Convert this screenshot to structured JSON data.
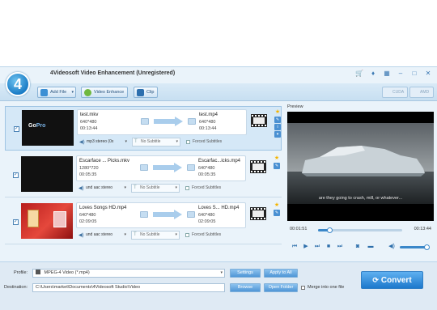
{
  "app": {
    "title": "4Videosoft Video Enhancement (Unregistered)",
    "logo_text": "4",
    "title_icons": [
      "cart-icon",
      "key-icon",
      "grid-icon",
      "minimize-icon",
      "maximize-icon",
      "close-icon"
    ]
  },
  "toolbar": {
    "add_file": "Add File",
    "video_enhance": "Video Enhance",
    "clip": "Clip",
    "cuda": "CUDA",
    "amd": "AMD"
  },
  "files": [
    {
      "checked": true,
      "source_name": "test.mkv",
      "source_res": "640*480",
      "source_dur": "00:13:44",
      "target_name": "test.mp4",
      "target_res": "640*480",
      "target_dur": "00:13:44",
      "audio": "mp3 stereo (0x",
      "subtitle": "No Subtitle",
      "forced": "Forced Subtitles",
      "thumb": "gopro",
      "thumb_text_a": "Go",
      "thumb_text_b": "Pro"
    },
    {
      "checked": true,
      "source_name": "Escarface ... Picks.mkv",
      "source_res": "1280*720",
      "source_dur": "00:05:35",
      "target_name": "Escarfac...icks.mp4",
      "target_res": "640*480",
      "target_dur": "00:05:35",
      "audio": "und aac stereo",
      "subtitle": "No Subtitle",
      "forced": "Forced Subtitles",
      "thumb": "black"
    },
    {
      "checked": true,
      "source_name": "Loves Songs HD.mp4",
      "source_res": "640*480",
      "source_dur": "02:09:05",
      "target_name": "Loves S... HD.mp4",
      "target_res": "640*480",
      "target_dur": "02:09:05",
      "audio": "und aac stereo",
      "subtitle": "No Subtitle",
      "forced": "Forced Subtitles",
      "thumb": "red"
    }
  ],
  "preview": {
    "label": "Preview",
    "subtitle_text": "are they going to crash, mill, or whatever...",
    "current_time": "00:01:51",
    "end_time": "00:13:44",
    "progress": 0.135,
    "volume": 1.0
  },
  "bottom": {
    "profile_label": "Profile:",
    "profile_value": "MPEG-4 Video (*.mp4)",
    "settings": "Settings",
    "apply_to_all": "Apply to All",
    "destination_label": "Destination:",
    "destination_value": "C:\\Users\\market\\Documents\\4Videosoft Studio\\Video",
    "browse": "Browse",
    "open_folder": "Open Folder",
    "merge": "Merge into one file",
    "convert": "Convert"
  }
}
